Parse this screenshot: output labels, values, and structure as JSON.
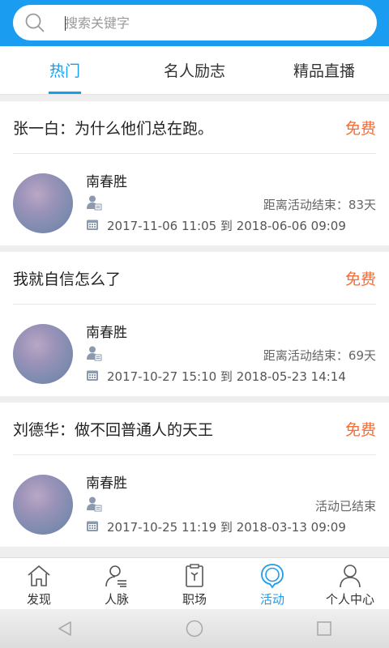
{
  "search": {
    "placeholder": "搜索关键字",
    "icon": "search-icon"
  },
  "tabs": [
    {
      "label": "热门",
      "active": true
    },
    {
      "label": "名人励志",
      "active": false
    },
    {
      "label": "精品直播",
      "active": false
    }
  ],
  "colors": {
    "accent": "#1a9df0",
    "price": "#ff6a2c",
    "list_bg": "#eeeeee"
  },
  "cards": [
    {
      "title": "张一白：为什么他们总在跑。",
      "price": "免费",
      "speaker": "南春胜",
      "countdown": "距离活动结束：83天",
      "time_range": "2017-11-06 11:05 到 2018-06-06 09:09"
    },
    {
      "title": "我就自信怎么了",
      "price": "免费",
      "speaker": "南春胜",
      "countdown": "距离活动结束：69天",
      "time_range": "2017-10-27 15:10 到 2018-05-23 14:14"
    },
    {
      "title": "刘德华：做不回普通人的天王",
      "price": "免费",
      "speaker": "南春胜",
      "countdown": "活动已结束",
      "time_range": "2017-10-25 11:19 到 2018-03-13 09:09"
    }
  ],
  "bottom_nav": [
    {
      "label": "发现",
      "icon": "home-icon",
      "active": false
    },
    {
      "label": "人脉",
      "icon": "contacts-icon",
      "active": false
    },
    {
      "label": "职场",
      "icon": "workplace-icon",
      "active": false
    },
    {
      "label": "活动",
      "icon": "activity-icon",
      "active": true
    },
    {
      "label": "个人中心",
      "icon": "profile-icon",
      "active": false
    }
  ]
}
